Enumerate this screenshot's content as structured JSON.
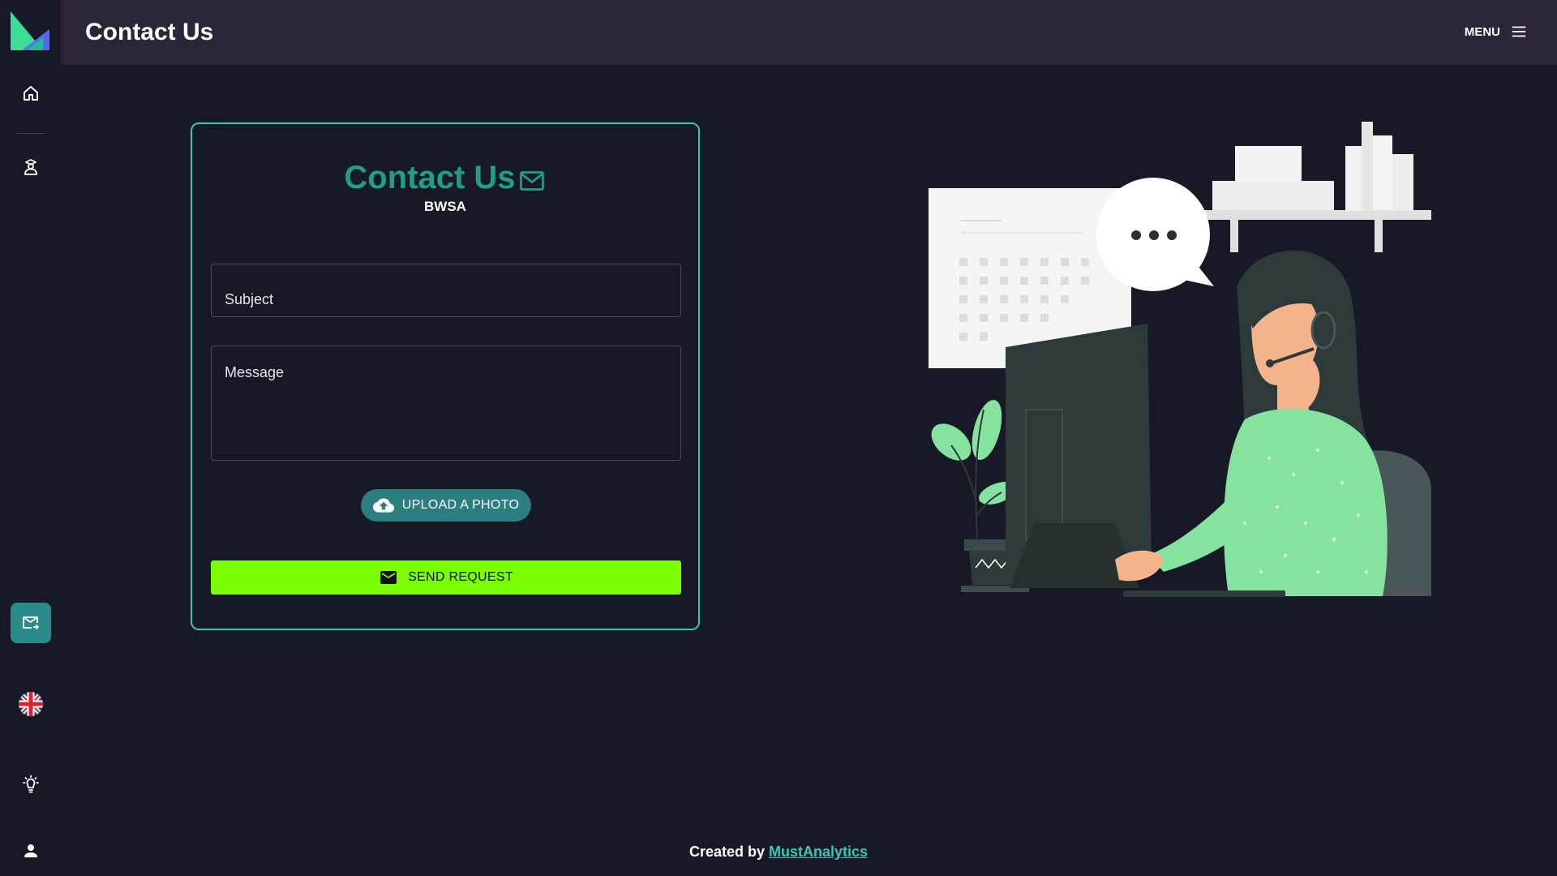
{
  "header": {
    "title": "Contact Us",
    "menu_label": "MENU"
  },
  "sidebar": {
    "items": [
      {
        "name": "home",
        "icon": "home-icon"
      },
      {
        "name": "graduate",
        "icon": "graduate-icon"
      },
      {
        "name": "contact",
        "icon": "mail-forward-icon",
        "active": true
      },
      {
        "name": "language",
        "icon": "uk-flag-icon"
      },
      {
        "name": "theme",
        "icon": "lightbulb-icon"
      },
      {
        "name": "account",
        "icon": "person-icon"
      }
    ]
  },
  "form": {
    "title": "Contact Us",
    "subtitle": "BWSA",
    "subject_placeholder": "Subject",
    "message_placeholder": "Message",
    "upload_label": "UPLOAD A PHOTO",
    "send_label": "SEND REQUEST"
  },
  "footer": {
    "prefix": "Created by",
    "link_text": "MustAnalytics"
  },
  "colors": {
    "background": "#181927",
    "header": "#2c2537",
    "accent_teal": "#33c9b4",
    "title_teal": "#1f9e8a",
    "upload_button": "#2a7e80",
    "send_button": "#7bff00"
  }
}
